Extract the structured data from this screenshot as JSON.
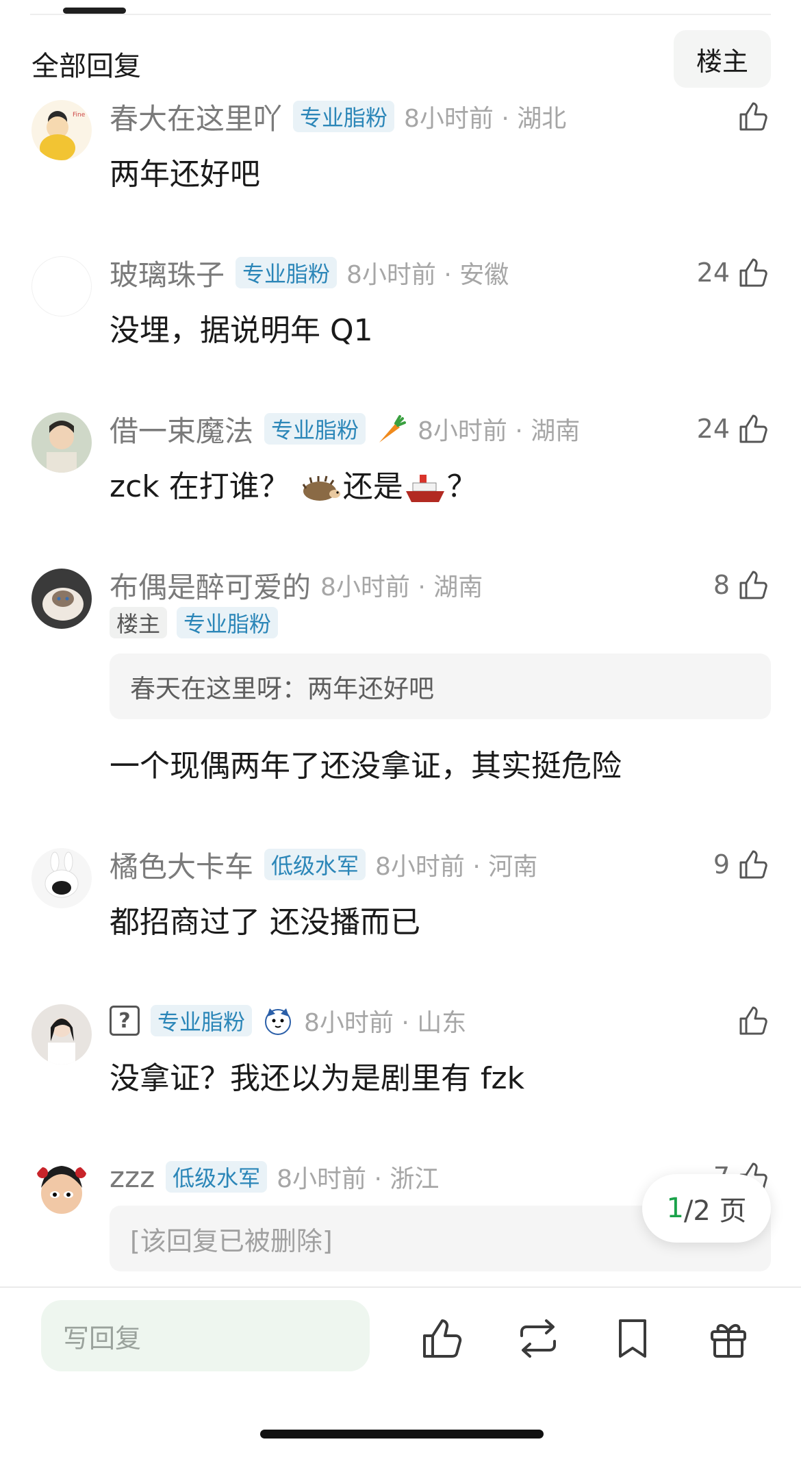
{
  "header": {
    "title": "全部回复",
    "op_filter_label": "楼主"
  },
  "comments": [
    {
      "username": "春大在这里吖",
      "badge": "专业脂粉",
      "time": "8小时前",
      "location": "湖北",
      "likes": "",
      "content": "两年还好吧"
    },
    {
      "username": "玻璃珠子",
      "badge": "专业脂粉",
      "time": "8小时前",
      "location": "安徽",
      "likes": "24",
      "content": "没埋，据说明年 Q1"
    },
    {
      "username": "借一束魔法",
      "badge": "专业脂粉",
      "time": "8小时前",
      "location": "湖南",
      "likes": "24",
      "content_pre": "zck 在打谁？",
      "content_mid": "还是",
      "content_post": "？"
    },
    {
      "username": "布偶是醉可爱的",
      "op_badge": "楼主",
      "badge": "专业脂粉",
      "time": "8小时前",
      "location": "湖南",
      "likes": "8",
      "quote": "春天在这里呀：两年还好吧",
      "content": "一个现偶两年了还没拿证，其实挺危险"
    },
    {
      "username": "橘色大卡车",
      "badge": "低级水军",
      "time": "8小时前",
      "location": "河南",
      "likes": "9",
      "content": "都招商过了  还没播而已"
    },
    {
      "username_icon": "?",
      "badge": "专业脂粉",
      "time": "8小时前",
      "location": "山东",
      "likes": "",
      "content": "没拿证？我还以为是剧里有 fzk"
    },
    {
      "username": "zzz",
      "badge": "低级水军",
      "time": "8小时前",
      "location": "浙江",
      "likes": "7",
      "content": "[该回复已被删除]"
    }
  ],
  "pagination": {
    "current": "1",
    "total_label": "/2 页"
  },
  "footer": {
    "reply_placeholder": "写回复"
  },
  "colors": {
    "badge_blue": "#2b86b8",
    "badge_bg": "#e9f2f7",
    "accent_green": "#1aa24a",
    "reply_bg": "#eef6ef"
  }
}
